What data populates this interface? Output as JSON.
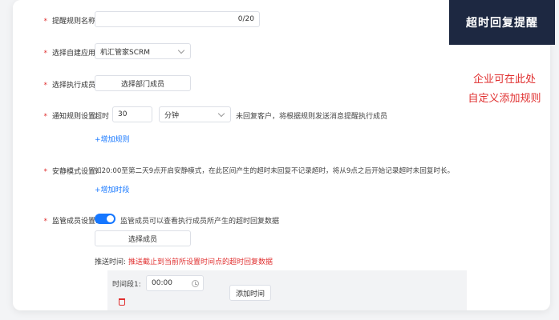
{
  "form": {
    "rule_name": {
      "label": "提醒规则名称:",
      "counter": "0/20",
      "value": ""
    },
    "app": {
      "label": "选择自建应用:",
      "value": "机汇管家SCRM"
    },
    "members": {
      "label": "选择执行成员:",
      "button": "选择部门成员"
    },
    "notify": {
      "label": "通知规则设置:",
      "prefix": "超时",
      "amount": "30",
      "unit": "分钟",
      "suffix": "未回复客户，将根据规则发送消息提醒执行成员",
      "add_link": "+增加规则"
    },
    "quiet": {
      "label": "安静模式设置:",
      "desc": "如20:00至第二天9点开启安静模式，在此区间产生的超时未回复不记录超时，将从9点之后开始记录超时未回复时长。",
      "add_link": "+增加时段"
    },
    "supervisor": {
      "label": "监管成员设置:",
      "toggle_text": "监管成员可以查看执行成员所产生的超时回复数据",
      "button": "选择成员",
      "push_label": "推送时间:",
      "push_text": "推送截止到当前所设置时间点的超时回复数据",
      "slot_label": "时间段1:",
      "slot_value": "00:00",
      "add_time": "添加时间"
    }
  },
  "banner": {
    "title": "超时回复提醒"
  },
  "side_note": {
    "line1": "企业可在此处",
    "line2": "自定义添加规则"
  },
  "colors": {
    "accent": "#1677ff",
    "required": "#e03030",
    "banner_bg": "#1d2841"
  }
}
